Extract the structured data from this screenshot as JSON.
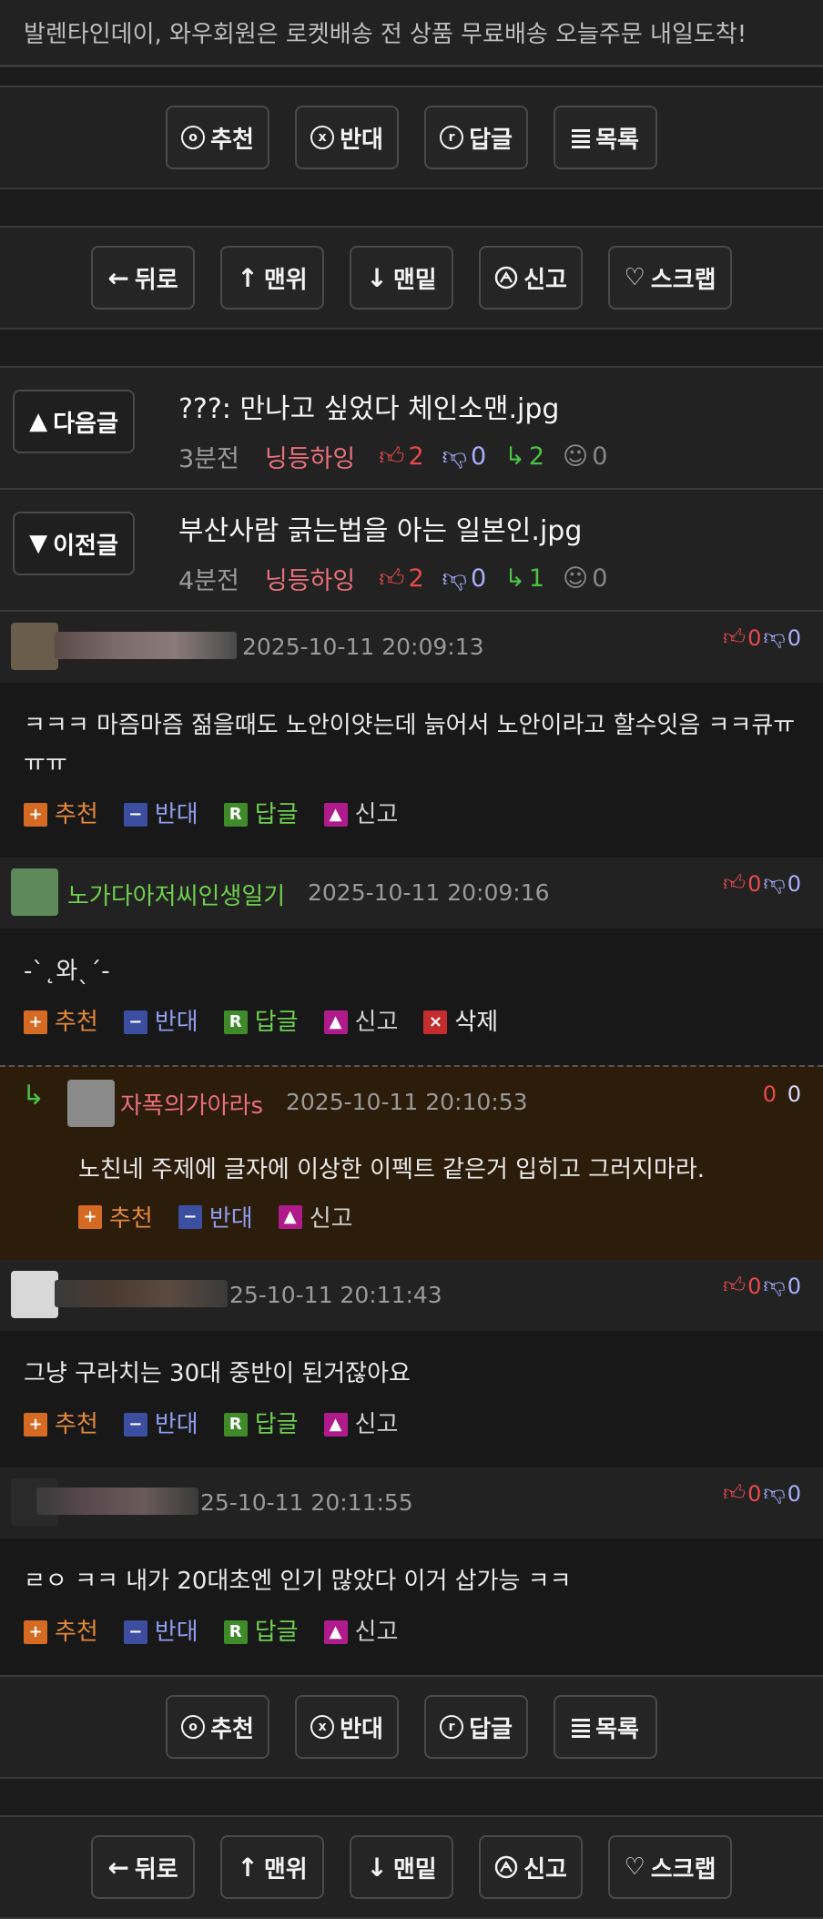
{
  "banner": "발렌타인데이, 와우회원은 로켓배송 전 상품 무료배송 오늘주문 내일도착!",
  "vote_bar": {
    "recommend": "추천",
    "oppose": "반대",
    "reply": "답글",
    "list": "목록"
  },
  "nav_bar": {
    "back": "뒤로",
    "top": "맨위",
    "bottom": "맨밑",
    "report": "신고",
    "scrap": "스크랩"
  },
  "next_post": {
    "button": "다음글",
    "title": "???: 만나고 싶었다 체인소맨.jpg",
    "time": "3분전",
    "author": "닝등하잉",
    "up": "2",
    "down": "0",
    "replies": "2",
    "views": "0"
  },
  "prev_post": {
    "button": "이전글",
    "title": "부산사람 긁는법을 아는 일본인.jpg",
    "time": "4분전",
    "author": "닝등하잉",
    "up": "2",
    "down": "0",
    "replies": "1",
    "views": "0"
  },
  "comment_actions": {
    "recommend": "추천",
    "oppose": "반대",
    "reply": "답글",
    "report": "신고",
    "delete": "삭제"
  },
  "comments": [
    {
      "date": "2025-10-11 20:09:13",
      "up": "0",
      "down": "0",
      "text": "ㅋㅋㅋ 마즘마즘 젊을때도 노안이얏는데 늙어서 노안이라고 할수잇음 ㅋㅋ큐ㅠㅠㅠ"
    },
    {
      "nick": "노가다아저씨인생일기",
      "date": "2025-10-11 20:09:16",
      "up": "0",
      "down": "0",
      "text": "-`˛와ˎ´-"
    },
    {
      "nick": "자폭의가아라s",
      "date": "2025-10-11 20:10:53",
      "up": "0",
      "down": "0",
      "text": "노친네 주제에 글자에 이상한 이펙트 같은거 입히고 그러지마라."
    },
    {
      "date": "25-10-11 20:11:43",
      "up": "0",
      "down": "0",
      "text": "그냥 구라치는 30대 중반이 된거잖아요"
    },
    {
      "date": "25-10-11 20:11:55",
      "up": "0",
      "down": "0",
      "text": "ㄹㅇ ㅋㅋ 내가 20대초엔 인기 많았다 이거 삽가능 ㅋㅋ"
    }
  ]
}
